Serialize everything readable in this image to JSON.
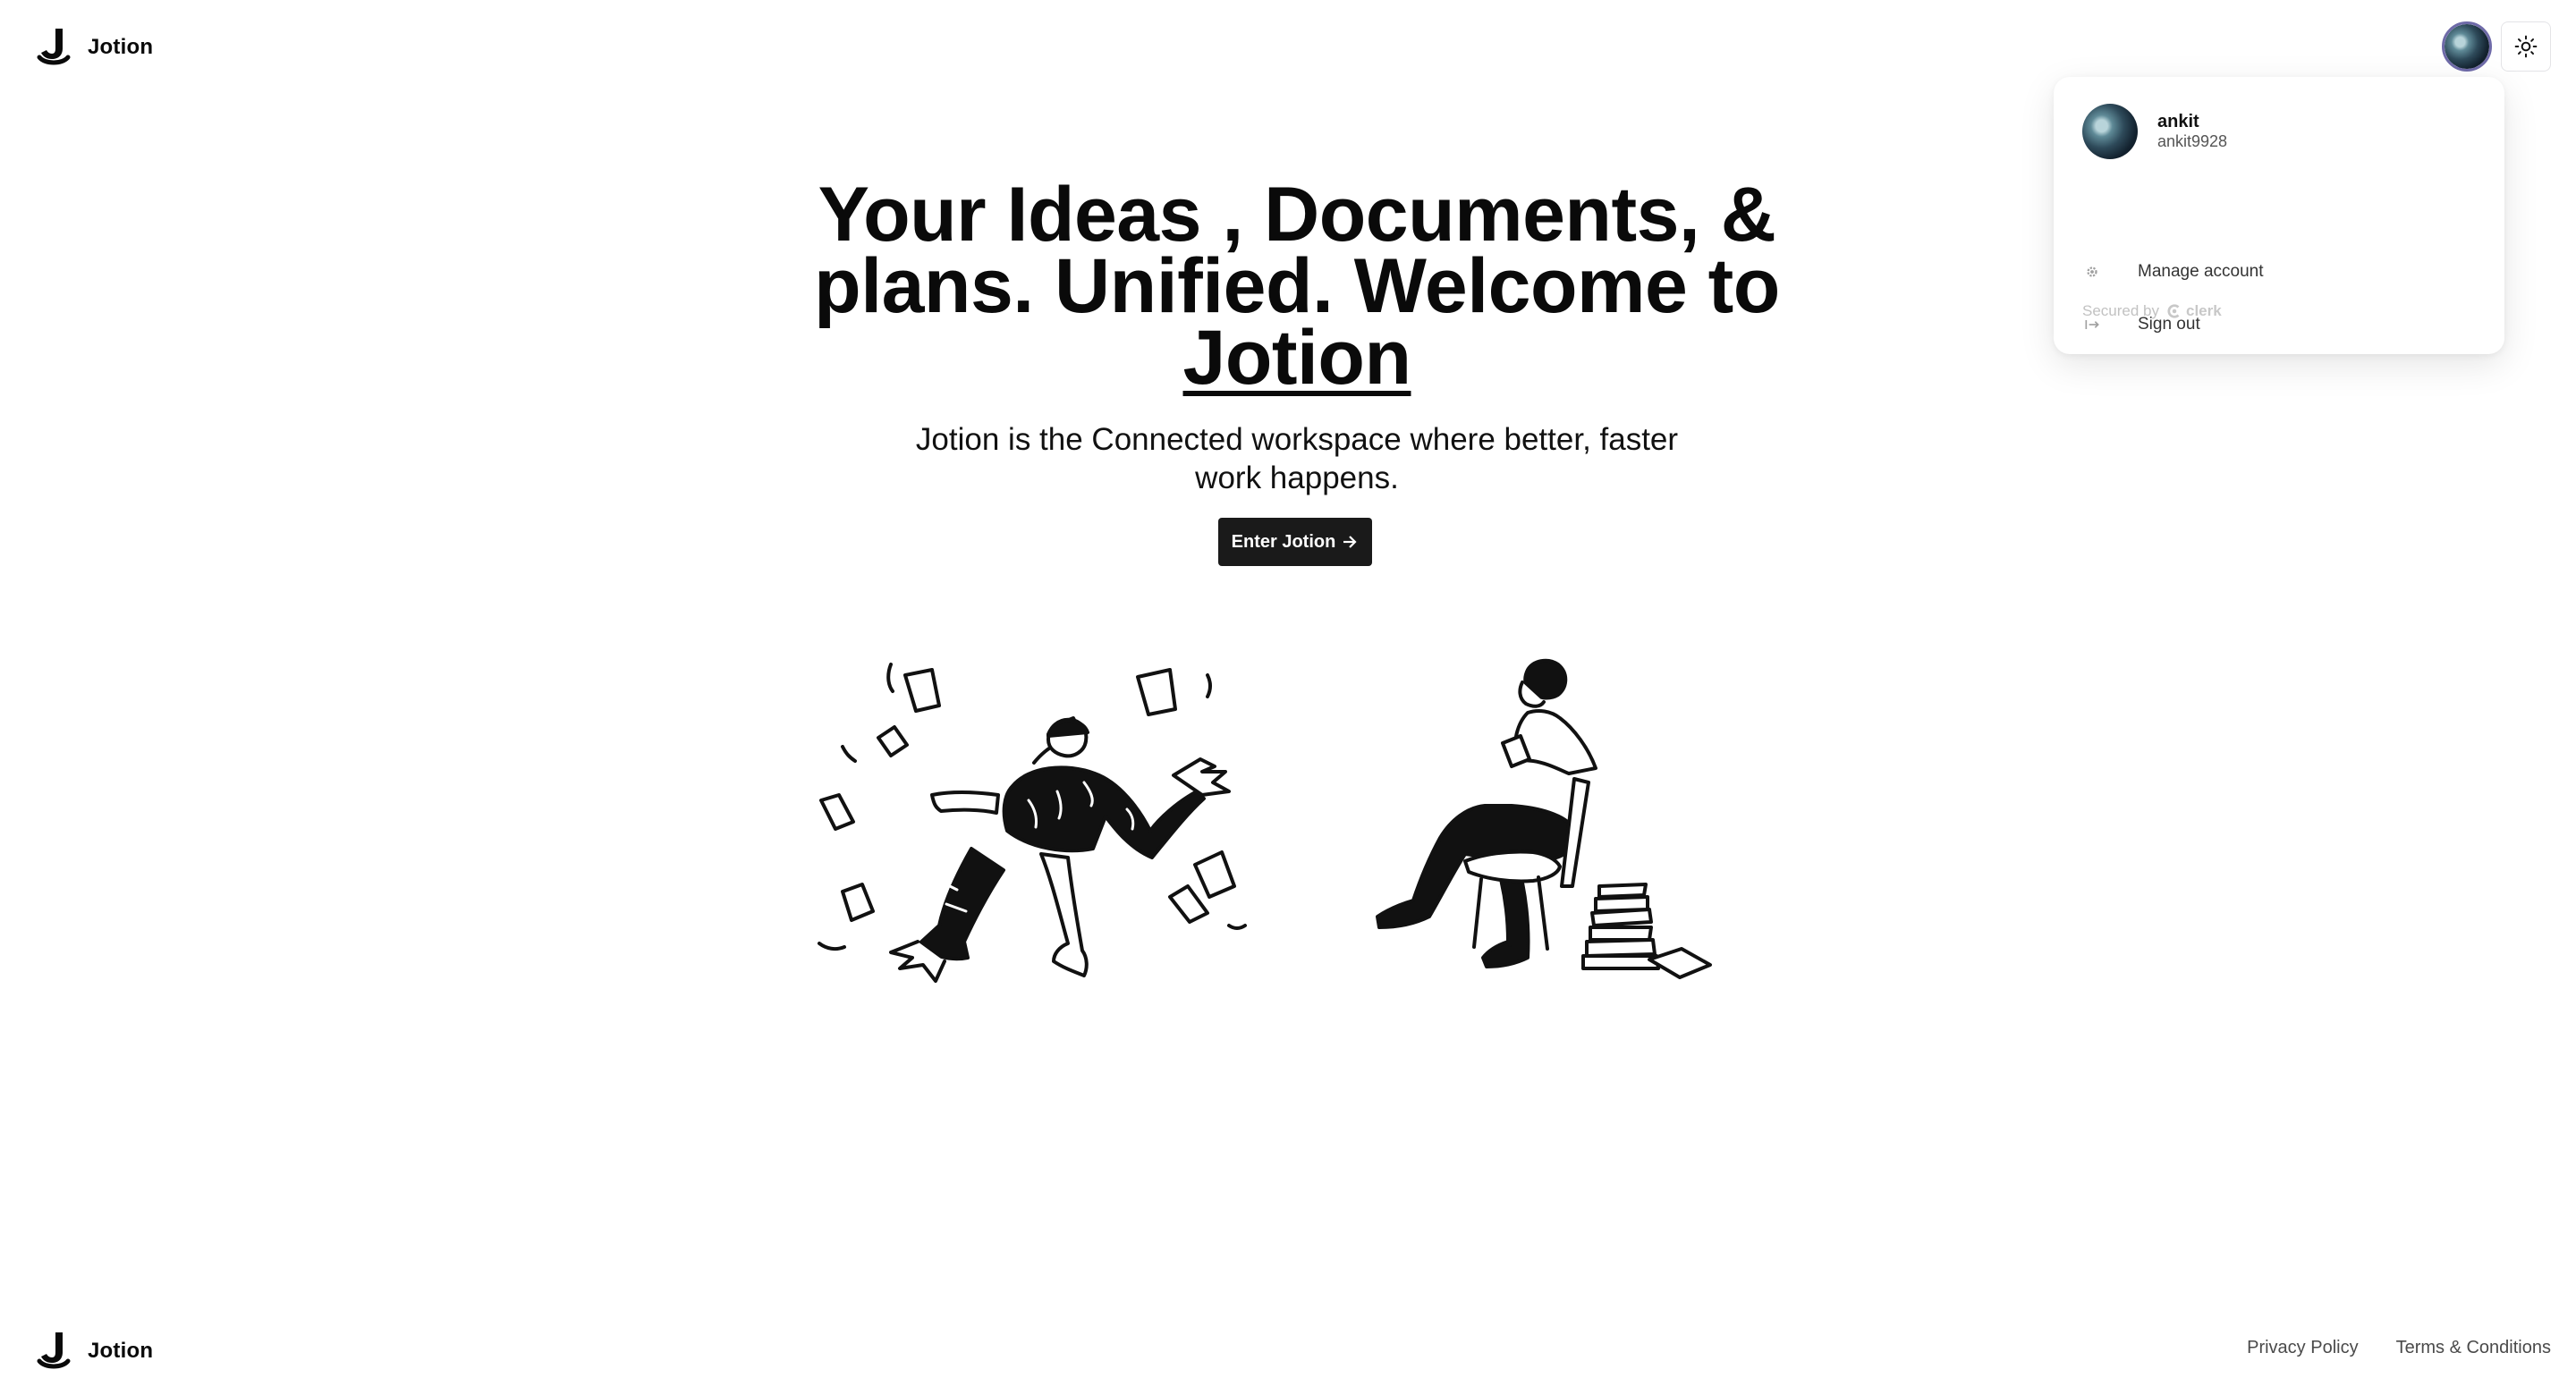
{
  "navbar": {
    "brand_name": "Jotion",
    "avatar_label": "ankit",
    "theme_icon": "sun-icon"
  },
  "user_menu": {
    "name": "ankit",
    "username": "ankit9928",
    "items": [
      {
        "label": "Manage account",
        "icon": "gear-icon"
      },
      {
        "label": "Sign out",
        "icon": "sign-out-icon"
      }
    ],
    "secured_by": "Secured by",
    "provider": "clerk"
  },
  "hero": {
    "title_part1": "Your Ideas , Documents, & plans. Unified. Welcome to ",
    "title_brand": "Jotion",
    "subtitle": "Jotion is the Connected workspace where better, faster work happens.",
    "cta_label": "Enter Jotion"
  },
  "footer": {
    "brand_name": "Jotion",
    "links": [
      "Privacy Policy",
      "Terms & Conditions"
    ]
  },
  "colors": {
    "cta_bg": "#1a1a1a",
    "avatar_ring": "#6e6aa8",
    "text": "#0a0a0a"
  }
}
